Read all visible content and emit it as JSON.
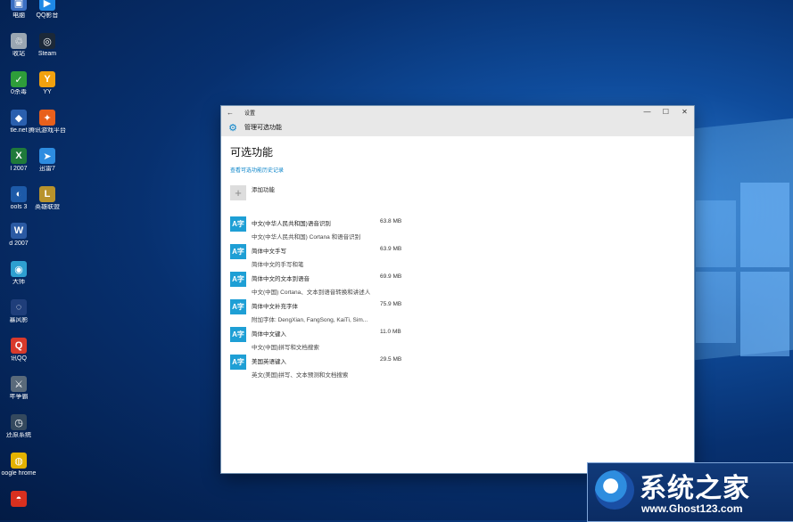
{
  "desktop_icons": [
    {
      "label": "电脑",
      "color": "#3b6fc2",
      "glyph": "▣"
    },
    {
      "label": "QQ影音",
      "color": "#1e88e5",
      "glyph": "▶"
    },
    {
      "label": "收站",
      "color": "#9aa6b2",
      "glyph": "♲"
    },
    {
      "label": "Steam",
      "color": "#1b2838",
      "glyph": "◎"
    },
    {
      "label": "0杀毒",
      "color": "#2e9d3a",
      "glyph": "✓"
    },
    {
      "label": "YY",
      "color": "#f2a10f",
      "glyph": "Y"
    },
    {
      "label": "tle.net",
      "color": "#2a5fae",
      "glyph": "◆"
    },
    {
      "label": "腾讯游戏平台",
      "color": "#e8601c",
      "glyph": "✦"
    },
    {
      "label": "l 2007",
      "color": "#1f7a3a",
      "glyph": "X"
    },
    {
      "label": "迅雷7",
      "color": "#2d8ce0",
      "glyph": "➤"
    },
    {
      "label": "ools 3",
      "color": "#1d5aa8",
      "glyph": "◐"
    },
    {
      "label": "英雄联盟",
      "color": "#b8932c",
      "glyph": "L"
    },
    {
      "label": "d 2007",
      "color": "#2b5aa3",
      "glyph": "W"
    },
    {
      "label": "大师",
      "color": "#2e9fd0",
      "glyph": "◉"
    },
    {
      "label": "暴风影",
      "color": "#1f3e7a",
      "glyph": "◌"
    },
    {
      "label": "讯QQ",
      "color": "#d93a2b",
      "glyph": "Q"
    },
    {
      "label": "年争霸",
      "color": "#5a6a7a",
      "glyph": "⚔"
    },
    {
      "label": "还原系统",
      "color": "#34495e",
      "glyph": "◷"
    },
    {
      "label": "oogle hrome",
      "color": "#e4b200",
      "glyph": "◍"
    },
    {
      "label": "",
      "color": "#d9301f",
      "glyph": "◓"
    }
  ],
  "window": {
    "back_symbol": "←",
    "title": "设置",
    "minimize": "—",
    "maximize": "☐",
    "close": "✕",
    "header_icon": "⚙",
    "header_title": "管理可选功能"
  },
  "page": {
    "title": "可选功能",
    "history_link": "查看可选功能历史记录",
    "add_label": "添加功能",
    "add_symbol": "+"
  },
  "features": [
    {
      "name": "中文(中华人民共和国)语音识别",
      "size": "63.8 MB",
      "desc": "中文(中华人民共和国) Cortana 和语音识别"
    },
    {
      "name": "简体中文手写",
      "size": "63.9 MB",
      "desc": "简体中文的手写和笔"
    },
    {
      "name": "简体中文的文本到语音",
      "size": "69.9 MB",
      "desc": "中文(中国) Cortana、文本到语音转换和讲述人"
    },
    {
      "name": "简体中文补充字体",
      "size": "75.9 MB",
      "desc": "附加字体: DengXian, FangSong, KaiTi, Sim..."
    },
    {
      "name": "简体中文键入",
      "size": "11.0 MB",
      "desc": "中文(中国)拼写和文档搜索"
    },
    {
      "name": "美国英语键入",
      "size": "29.5 MB",
      "desc": "英文(美国)拼写、文本预测和文档搜索"
    }
  ],
  "feature_icon_glyph": "A字",
  "watermark": {
    "text": "系统之家",
    "url": "www.Ghost123.com"
  }
}
